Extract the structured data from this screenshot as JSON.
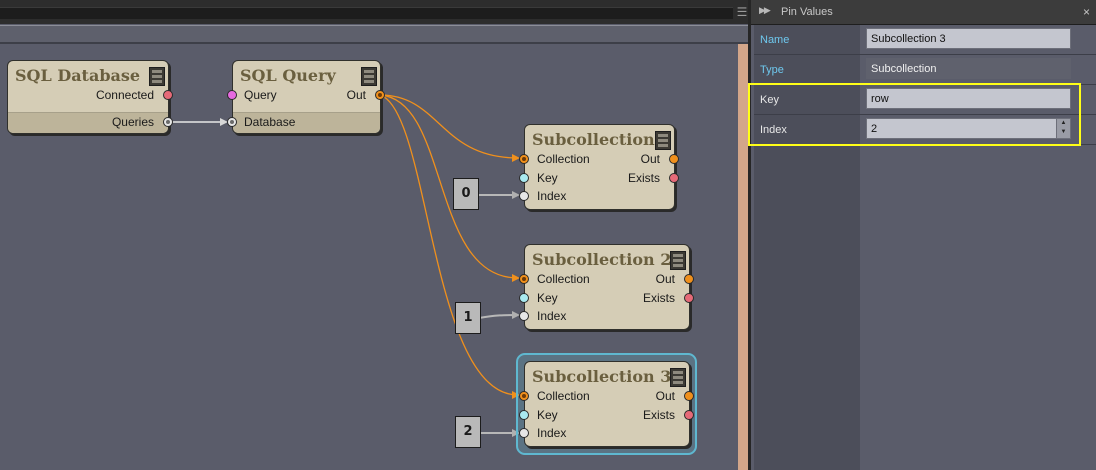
{
  "graph": {
    "nodes": {
      "sql_database": {
        "title": "SQL Database",
        "connected": "Connected",
        "queries": "Queries"
      },
      "sql_query": {
        "title": "SQL Query",
        "query": "Query",
        "out": "Out",
        "database": "Database"
      },
      "sub1": {
        "title": "Subcollection",
        "collection": "Collection",
        "out": "Out",
        "key": "Key",
        "exists": "Exists",
        "index": "Index"
      },
      "sub2": {
        "title": "Subcollection 2",
        "collection": "Collection",
        "out": "Out",
        "key": "Key",
        "exists": "Exists",
        "index": "Index"
      },
      "sub3": {
        "title": "Subcollection 3",
        "collection": "Collection",
        "out": "Out",
        "key": "Key",
        "exists": "Exists",
        "index": "Index"
      }
    },
    "constants": [
      "0",
      "1",
      "2"
    ],
    "colors": {
      "wire_orange": "#f0901c",
      "wire_white": "#cfcfcf",
      "selection": "#5fb8d0",
      "highlight": "#ffff17"
    }
  },
  "pin_values": {
    "title": "Pin Values",
    "rows": [
      {
        "label": "Name",
        "value": "Subcollection 3",
        "label_color": "#6ec8ee"
      },
      {
        "label": "Type",
        "value": "Subcollection",
        "label_color": "#6ec8ee"
      },
      {
        "label": "Key",
        "value": "row",
        "label_color": "#e8e8e8"
      },
      {
        "label": "Index",
        "value": "2",
        "label_color": "#e8e8e8"
      }
    ]
  }
}
